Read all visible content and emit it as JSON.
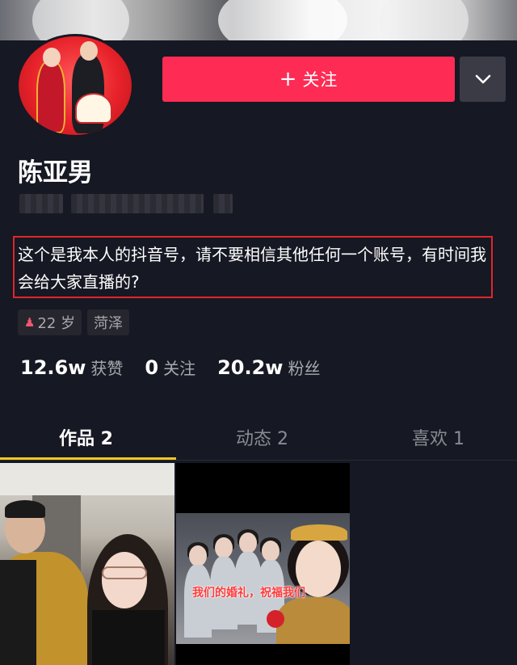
{
  "header": {
    "follow_label": "关注",
    "follow_plus": "+",
    "more_icon": "chevron-down-icon"
  },
  "profile": {
    "nickname": "陈亚男",
    "bio": "这个是我本人的抖音号，请不要相信其他任何一个账号，有时间我会给大家直播的?",
    "tags": {
      "age": "22 岁",
      "location": "菏泽"
    }
  },
  "stats": [
    {
      "num": "12.6w",
      "label": "获赞"
    },
    {
      "num": "0",
      "label": "关注"
    },
    {
      "num": "20.2w",
      "label": "粉丝"
    }
  ],
  "tabs": [
    {
      "label": "作品 2",
      "active": true
    },
    {
      "label": "动态 2",
      "active": false
    },
    {
      "label": "喜欢 1",
      "active": false
    }
  ],
  "videos": [
    {
      "caption": ""
    },
    {
      "caption": "我们的婚礼，祝福我们"
    }
  ],
  "colors": {
    "background": "#161823",
    "follow_button": "#fe2c55",
    "tab_indicator": "#f5c724",
    "highlight_box": "#e0262b"
  }
}
